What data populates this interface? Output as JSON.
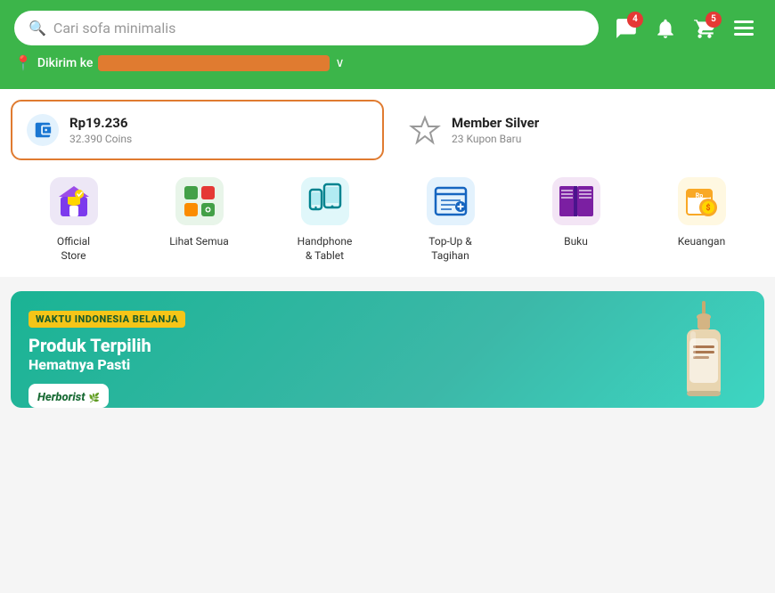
{
  "header": {
    "search_placeholder": "Cari sofa minimalis",
    "location_label": "Dikirim ke",
    "message_badge": "4",
    "cart_badge": "5"
  },
  "balance": {
    "amount": "Rp19.236",
    "coins": "32.390 Coins",
    "member_title": "Member Silver",
    "member_subtitle": "23 Kupon Baru"
  },
  "categories": [
    {
      "id": "official-store",
      "label": "Official\nStore",
      "label1": "Official",
      "label2": "Store"
    },
    {
      "id": "lihat-semua",
      "label": "Lihat Semua",
      "label1": "Lihat Semua",
      "label2": ""
    },
    {
      "id": "handphone-tablet",
      "label": "Handphone\n& Tablet",
      "label1": "Handphone",
      "label2": "& Tablet"
    },
    {
      "id": "topup-tagihan",
      "label": "Top-Up &\nTagihan",
      "label1": "Top-Up &",
      "label2": "Tagihan"
    },
    {
      "id": "buku",
      "label": "Buku",
      "label1": "Buku",
      "label2": ""
    },
    {
      "id": "keuangan",
      "label": "Keuangan",
      "label1": "Keuangan",
      "label2": ""
    }
  ],
  "banner": {
    "tag": "WAKTU INDONESIA BELANJA",
    "title": "Produk Terpilih",
    "subtitle": "Hematnya Pasti",
    "brand": "Herborist"
  }
}
